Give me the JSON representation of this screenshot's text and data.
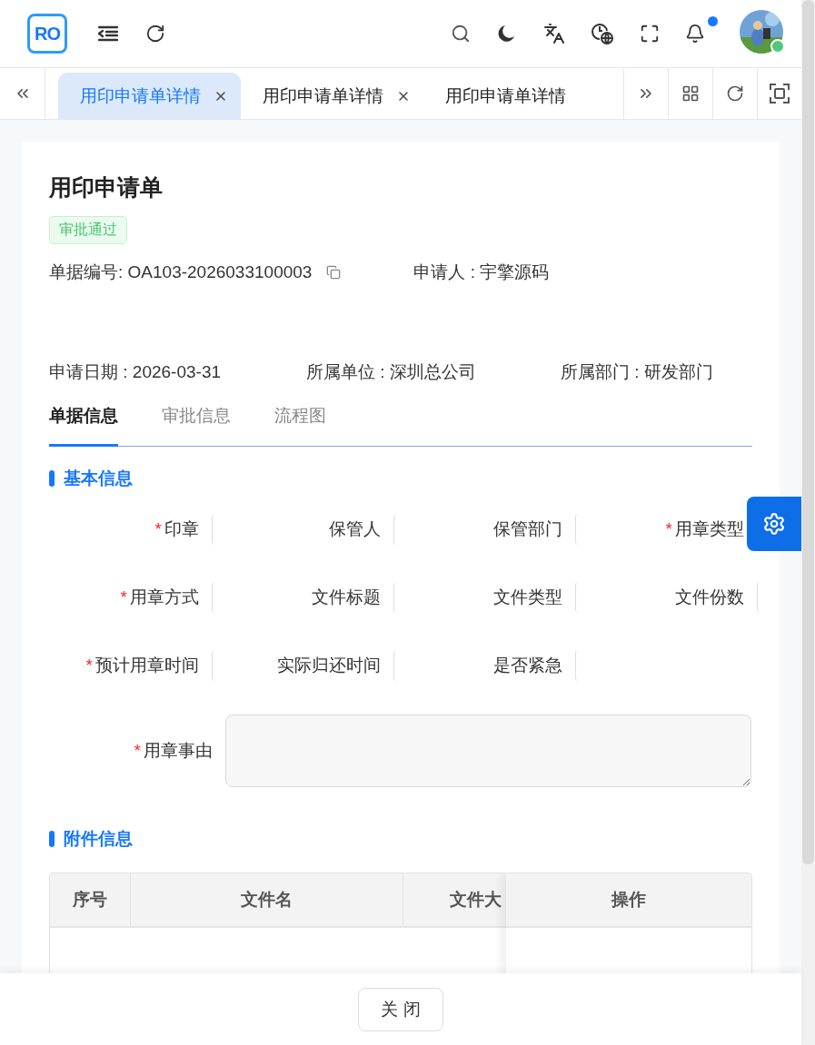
{
  "header": {
    "logo": "RO",
    "notification_dot": true,
    "user_online": true
  },
  "tabs": [
    {
      "label": "用印申请单详情",
      "selected": true,
      "closable": true
    },
    {
      "label": "用印申请单详情",
      "selected": false,
      "closable": true
    },
    {
      "label": "用印申请单详情",
      "selected": false,
      "closable": false
    }
  ],
  "document": {
    "title": "用印申请单",
    "status_tag": "审批通过",
    "info_rows": [
      [
        "单据编号: OA103-2026033100003",
        "申请人 : 宇擎源码"
      ],
      [
        "申请日期 : 2026-03-31",
        "所属单位 : 深圳总公司",
        "所属部门 : 研发部门"
      ]
    ],
    "detail_tabs": [
      {
        "label": "单据信息",
        "selected": true
      },
      {
        "label": "审批信息",
        "selected": false
      },
      {
        "label": "流程图",
        "selected": false
      }
    ],
    "sections": [
      {
        "title": "基本信息"
      },
      {
        "title": "附件信息"
      }
    ],
    "fields": [
      {
        "label": "印章",
        "required_mark": "*"
      },
      {
        "label": "保管人"
      },
      {
        "label": "保管部门"
      },
      {
        "label": "用章类型",
        "required_mark": "*"
      },
      {
        "label": "用章方式",
        "required_mark": "*"
      },
      {
        "label": "文件标题"
      },
      {
        "label": "文件类型"
      },
      {
        "label": "文件份数"
      },
      {
        "label": "预计用章时间",
        "required_mark": "*"
      },
      {
        "label": "实际归还时间"
      },
      {
        "label": "是否紧急"
      }
    ],
    "reason": {
      "label": "用章事由",
      "required_mark": "*"
    },
    "attachments_table": {
      "columns": [
        "序号",
        "文件名",
        "文件大"
      ],
      "fixed_column": "操作"
    }
  },
  "footer": {
    "close_button": "关 闭"
  }
}
